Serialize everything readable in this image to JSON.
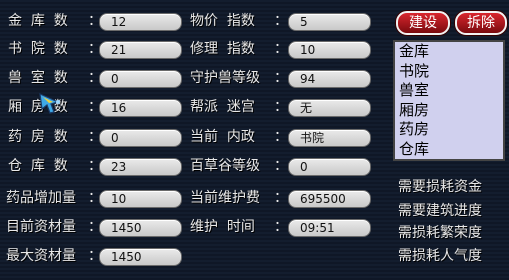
{
  "stats": [
    {
      "label": "金  库  数",
      "value": "12"
    },
    {
      "label": "书  院  数",
      "value": "21"
    },
    {
      "label": "兽  室  数",
      "value": "0"
    },
    {
      "label": "厢  房  数",
      "value": "16"
    },
    {
      "label": "药  房  数",
      "value": "0"
    },
    {
      "label": "仓  库  数",
      "value": "23"
    },
    {
      "label": "药品增加量",
      "value": "10"
    },
    {
      "label": "目前资材量",
      "value": "1450"
    },
    {
      "label": "最大资材量",
      "value": "1450"
    }
  ],
  "stats2": [
    {
      "label": "物价  指数",
      "value": "5"
    },
    {
      "label": "修理  指数",
      "value": "10"
    },
    {
      "label": "守护兽等级",
      "value": "94"
    },
    {
      "label": "帮派  迷宫",
      "value": "无"
    },
    {
      "label": "当前  内政",
      "value": "书院"
    },
    {
      "label": "百草谷等级",
      "value": "0"
    },
    {
      "label": "当前维护费",
      "value": "695500"
    },
    {
      "label": "维护  时间",
      "value": "09:51"
    }
  ],
  "colon": "：",
  "buttons": {
    "build": "建设",
    "demolish": "拆除"
  },
  "building_list": [
    "金库",
    "书院",
    "兽室",
    "厢房",
    "药房",
    "仓库"
  ],
  "requirements": [
    "需要损耗资金",
    "需要建筑进度",
    "需损耗繁荣度",
    "需损耗人气度"
  ],
  "colors": {
    "button_red": "#b3141c",
    "list_bg": "#d0d0ee",
    "field_bg": "#dcdcdc"
  },
  "icons": {
    "cursor": "cursor-icon"
  }
}
